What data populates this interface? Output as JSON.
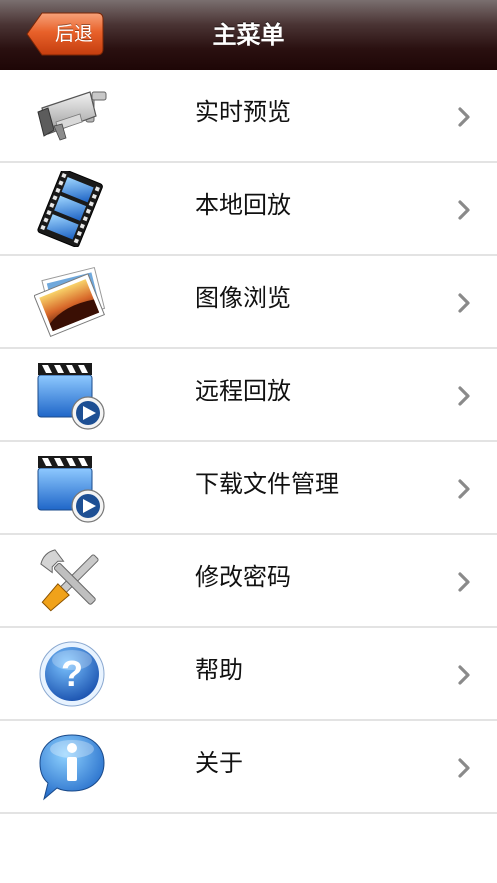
{
  "navbar": {
    "back_label": "后退",
    "title": "主菜单"
  },
  "menu": {
    "items": [
      {
        "label": "实时预览",
        "icon": "security-camera-icon"
      },
      {
        "label": "本地回放",
        "icon": "film-reel-icon"
      },
      {
        "label": "图像浏览",
        "icon": "photo-gallery-icon"
      },
      {
        "label": "远程回放",
        "icon": "clapperboard-play-icon"
      },
      {
        "label": "下载文件管理",
        "icon": "clapperboard-play-icon"
      },
      {
        "label": "修改密码",
        "icon": "tools-icon"
      },
      {
        "label": "帮助",
        "icon": "help-icon"
      },
      {
        "label": "关于",
        "icon": "info-icon"
      }
    ]
  },
  "colors": {
    "navbar_dark": "#1e0606",
    "back_button": "#e0521e",
    "divider": "#e3e3e3",
    "chevron": "#8a8a8a"
  }
}
